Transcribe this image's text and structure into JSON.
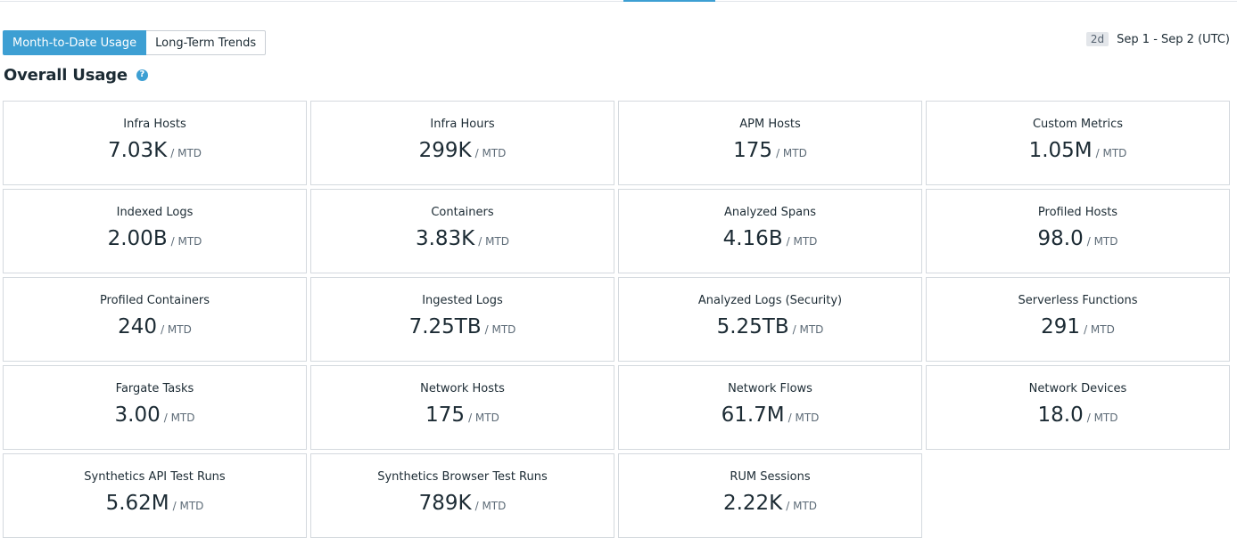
{
  "tabs": {
    "month_to_date": "Month-to-Date Usage",
    "long_term": "Long-Term Trends"
  },
  "range": {
    "badge": "2d",
    "text": "Sep 1 - Sep 2 (UTC)"
  },
  "section": {
    "title": "Overall Usage",
    "help_glyph": "?"
  },
  "unit_suffix": "/ MTD",
  "cards": [
    {
      "label": "Infra Hosts",
      "value": "7.03K"
    },
    {
      "label": "Infra Hours",
      "value": "299K"
    },
    {
      "label": "APM Hosts",
      "value": "175"
    },
    {
      "label": "Custom Metrics",
      "value": "1.05M"
    },
    {
      "label": "Indexed Logs",
      "value": "2.00B"
    },
    {
      "label": "Containers",
      "value": "3.83K"
    },
    {
      "label": "Analyzed Spans",
      "value": "4.16B"
    },
    {
      "label": "Profiled Hosts",
      "value": "98.0"
    },
    {
      "label": "Profiled Containers",
      "value": "240"
    },
    {
      "label": "Ingested Logs",
      "value": "7.25TB"
    },
    {
      "label": "Analyzed Logs (Security)",
      "value": "5.25TB"
    },
    {
      "label": "Serverless Functions",
      "value": "291"
    },
    {
      "label": "Fargate Tasks",
      "value": "3.00"
    },
    {
      "label": "Network Hosts",
      "value": "175"
    },
    {
      "label": "Network Flows",
      "value": "61.7M"
    },
    {
      "label": "Network Devices",
      "value": "18.0"
    },
    {
      "label": "Synthetics API Test Runs",
      "value": "5.62M"
    },
    {
      "label": "Synthetics Browser Test Runs",
      "value": "789K"
    },
    {
      "label": "RUM Sessions",
      "value": "2.22K"
    }
  ],
  "colors": {
    "accent": "#3d9fd3",
    "text": "#1c2b34",
    "border": "#d4d9de"
  }
}
